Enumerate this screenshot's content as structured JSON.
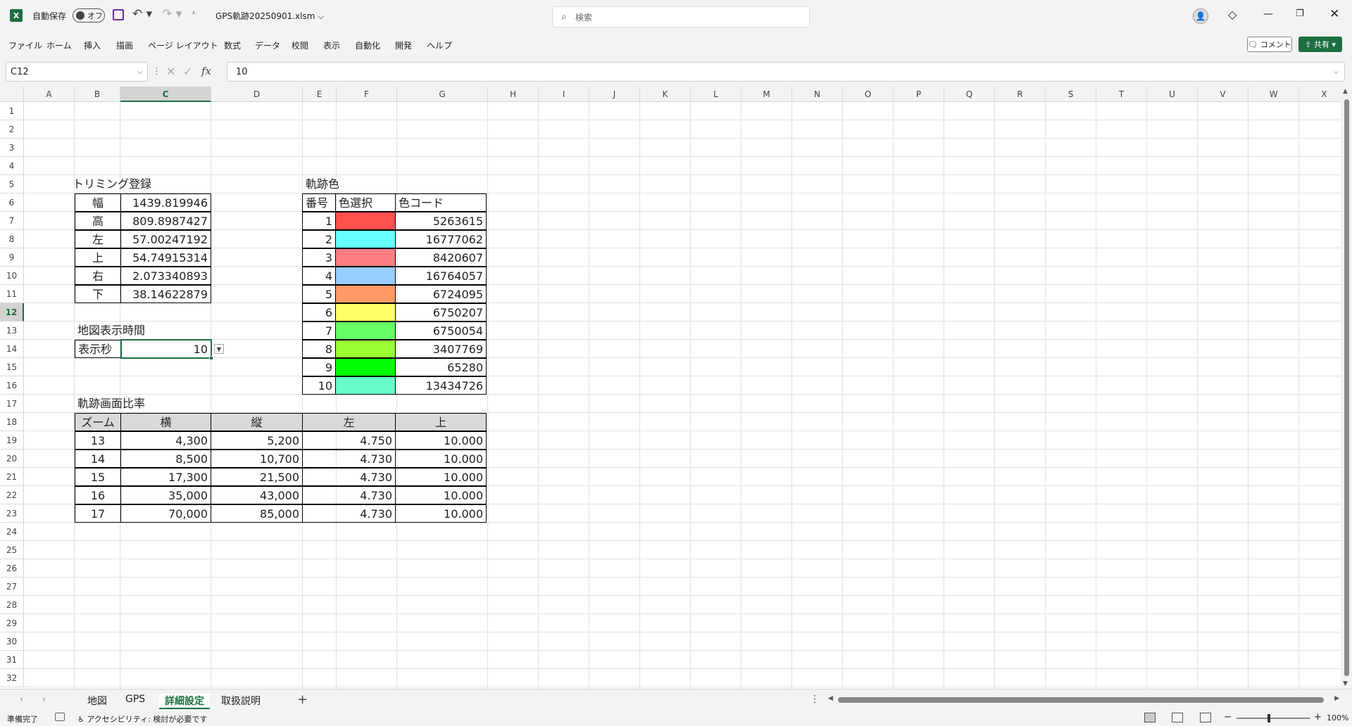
{
  "titlebar": {
    "autosave_label": "自動保存",
    "autosave_state": "オフ",
    "file_title": "GPS軌跡20250901.xlsm ⌵",
    "search_placeholder": "検索",
    "brand_color": "#1d6f42"
  },
  "menu": [
    "ファイル",
    "ホーム",
    "挿入",
    "描画",
    "ページ レイアウト",
    "数式",
    "データ",
    "校閲",
    "表示",
    "自動化",
    "開発",
    "ヘルプ"
  ],
  "actions": {
    "comment": "コメント",
    "share": "共有"
  },
  "formula_bar": {
    "name_box": "C12",
    "formula": "10"
  },
  "columns": [
    "A",
    "B",
    "C",
    "D",
    "E",
    "F",
    "G",
    "H",
    "I",
    "J",
    "K",
    "L",
    "M",
    "N",
    "O",
    "P",
    "Q",
    "R",
    "S",
    "T",
    "U",
    "V",
    "W",
    "X"
  ],
  "rows": [
    "1",
    "2",
    "3",
    "4",
    "5",
    "6",
    "7",
    "8",
    "9",
    "10",
    "11",
    "12",
    "13",
    "14",
    "15",
    "16",
    "17",
    "18",
    "19",
    "20",
    "21",
    "22",
    "23",
    "24",
    "25",
    "26",
    "27",
    "28",
    "29",
    "30",
    "31",
    "32"
  ],
  "trimming": {
    "title": "トリミング登録",
    "rows": [
      {
        "label": "幅",
        "value": "1439.819946"
      },
      {
        "label": "高",
        "value": "809.8987427"
      },
      {
        "label": "左",
        "value": "57.00247192"
      },
      {
        "label": "上",
        "value": "54.74915314"
      },
      {
        "label": "右",
        "value": "2.073340893"
      },
      {
        "label": "下",
        "value": "38.14622879"
      }
    ]
  },
  "display_time": {
    "title": "地図表示時間",
    "label": "表示秒",
    "value": "10"
  },
  "track_colors": {
    "title": "軌跡色",
    "headers": [
      "番号",
      "色選択",
      "色コード"
    ],
    "rows": [
      {
        "no": "1",
        "color": "#ff5050",
        "code": "5263615"
      },
      {
        "no": "2",
        "color": "#66ffff",
        "code": "16777062"
      },
      {
        "no": "3",
        "color": "#ff7c80",
        "code": "8420607"
      },
      {
        "no": "4",
        "color": "#99ccff",
        "code": "16764057"
      },
      {
        "no": "5",
        "color": "#ff9966",
        "code": "6724095"
      },
      {
        "no": "6",
        "color": "#ffff66",
        "code": "6750207"
      },
      {
        "no": "7",
        "color": "#66ff66",
        "code": "6750054"
      },
      {
        "no": "8",
        "color": "#99ff33",
        "code": "3407769"
      },
      {
        "no": "9",
        "color": "#00ff00",
        "code": "65280"
      },
      {
        "no": "10",
        "color": "#66ffcc",
        "code": "13434726"
      }
    ]
  },
  "screen_ratio": {
    "title": "軌跡画面比率",
    "headers": [
      "ズーム",
      "横",
      "縦",
      "左",
      "上"
    ],
    "rows": [
      [
        "13",
        "4,300",
        "5,200",
        "4.750",
        "10.000"
      ],
      [
        "14",
        "8,500",
        "10,700",
        "4.730",
        "10.000"
      ],
      [
        "15",
        "17,300",
        "21,500",
        "4.730",
        "10.000"
      ],
      [
        "16",
        "35,000",
        "43,000",
        "4.730",
        "10.000"
      ],
      [
        "17",
        "70,000",
        "85,000",
        "4.730",
        "10.000"
      ]
    ]
  },
  "sheet_tabs": [
    "地図",
    "GPS",
    "詳細設定",
    "取扱説明"
  ],
  "active_sheet": "詳細設定",
  "status": {
    "ready": "準備完了",
    "accessibility": "アクセシビリティ: 検討が必要です",
    "zoom": "100%"
  }
}
